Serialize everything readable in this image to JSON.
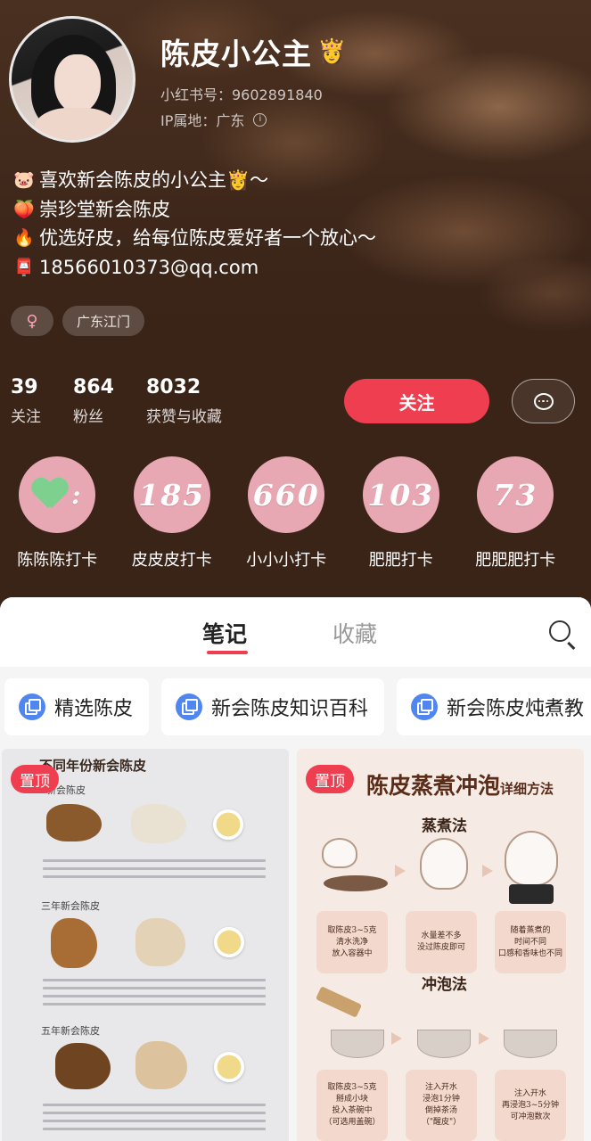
{
  "profile": {
    "name": "陈皮小公主",
    "name_emoji": "👸",
    "red_id": "小红书号：9602891840",
    "ip": "IP属地：广东",
    "bio": [
      {
        "emoji": "🐷",
        "text": "喜欢新会陈皮的小公主👸～"
      },
      {
        "emoji": "🍑",
        "text": "崇珍堂新会陈皮"
      },
      {
        "emoji": "🔥",
        "text": "优选好皮，给每位陈皮爱好者一个放心～"
      },
      {
        "emoji": "📮",
        "text": "18566010373@qq.com"
      }
    ],
    "tags": {
      "gender": "♀",
      "location": "广东江门"
    }
  },
  "stats": [
    {
      "num": "39",
      "label": "关注"
    },
    {
      "num": "864",
      "label": "粉丝"
    },
    {
      "num": "8032",
      "label": "获赞与收藏"
    }
  ],
  "actions": {
    "follow": "关注",
    "message_icon": "chat-bubble-icon"
  },
  "highlights": [
    {
      "value": ":",
      "label": "陈陈陈打卡",
      "icon": "green-heart"
    },
    {
      "value": "185",
      "label": "皮皮皮打卡"
    },
    {
      "value": "660",
      "label": "小小小打卡"
    },
    {
      "value": "103",
      "label": "肥肥打卡"
    },
    {
      "value": "73",
      "label": "肥肥肥打卡"
    }
  ],
  "tabs": [
    {
      "label": "笔记",
      "active": true
    },
    {
      "label": "收藏",
      "active": false
    }
  ],
  "collections": [
    "精选陈皮",
    "新会陈皮知识百科",
    "新会陈皮炖煮教"
  ],
  "notes": [
    {
      "pin": "置顶",
      "title": "不同年份新会陈皮",
      "sections": [
        "新会陈皮",
        "三年新会陈皮",
        "五年新会陈皮"
      ]
    },
    {
      "pin": "置顶",
      "title": "陈皮蒸煮冲泡",
      "title_small": "详细方法",
      "sections": [
        "蒸煮法",
        "冲泡法"
      ],
      "steps_steam": [
        "取陈皮3~5克\n清水洗净\n放入容器中",
        "水量差不多\n没过陈皮即可",
        "随着蒸煮的\n时间不同\n口感和香味也不同"
      ],
      "steps_brew": [
        "取陈皮3~5克\n掰成小块\n投入茶碗中\n（可选用盖碗）",
        "注入开水\n浸泡1分钟\n倒掉茶汤\n（\"醒皮\"）",
        "注入开水\n再浸泡3~5分钟\n可冲泡数次"
      ]
    }
  ],
  "colors": {
    "accent": "#ef3e4f",
    "highlight_circle": "#e7a8b4",
    "collection_icon": "#4f86f0"
  }
}
